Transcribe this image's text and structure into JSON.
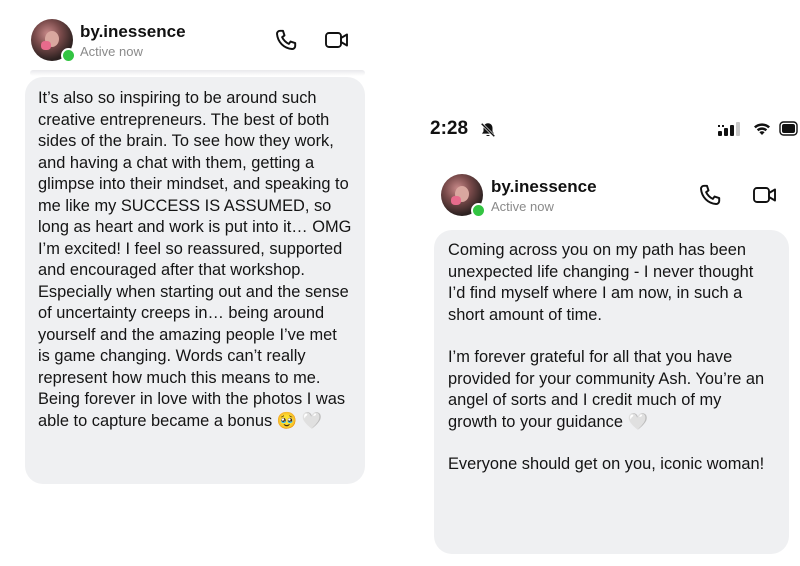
{
  "left_screen": {
    "header": {
      "username": "by.inessence",
      "status": "Active now",
      "call_icon": "phone-icon",
      "video_icon": "video-camera-icon"
    },
    "message": {
      "text": "It’s also so inspiring to be around such creative entrepreneurs. The best of both sides of the brain. To see how they work, and having a chat with them, getting a glimpse into their mindset, and speaking to me like my SUCCESS IS ASSUMED, so long as heart and work is put into it… OMG I’m excited! I feel so reassured, supported and encouraged after that workshop. Especially when starting out and the sense of uncertainty creeps in… being around yourself and the amazing people I’ve met is game changing. Words can’t really represent how much this means to me. Being forever in love with the photos I was able to capture became a bonus 🥹 🤍"
    }
  },
  "right_screen": {
    "status_bar": {
      "time": "2:28",
      "silent_icon": "bell-slash-icon",
      "signal_icon": "signal-icon",
      "wifi_icon": "wifi-icon",
      "battery_icon": "battery-icon"
    },
    "header": {
      "username": "by.inessence",
      "status": "Active now",
      "call_icon": "phone-icon",
      "video_icon": "video-camera-icon"
    },
    "message": {
      "paragraph_1": "Coming across you on my path has been unexpected life changing - I never thought I’d find myself where I am now, in such a short amount of time.",
      "paragraph_2": "I’m forever grateful for all that you have provided for your community Ash. You’re an angel of sorts and I credit much of my growth to your guidance 🤍",
      "paragraph_3": "Everyone should get on you, iconic woman!"
    }
  },
  "colors": {
    "bubble_bg": "#eff0f2",
    "online_green": "#33c442",
    "muted_text": "#8a8a8a"
  }
}
